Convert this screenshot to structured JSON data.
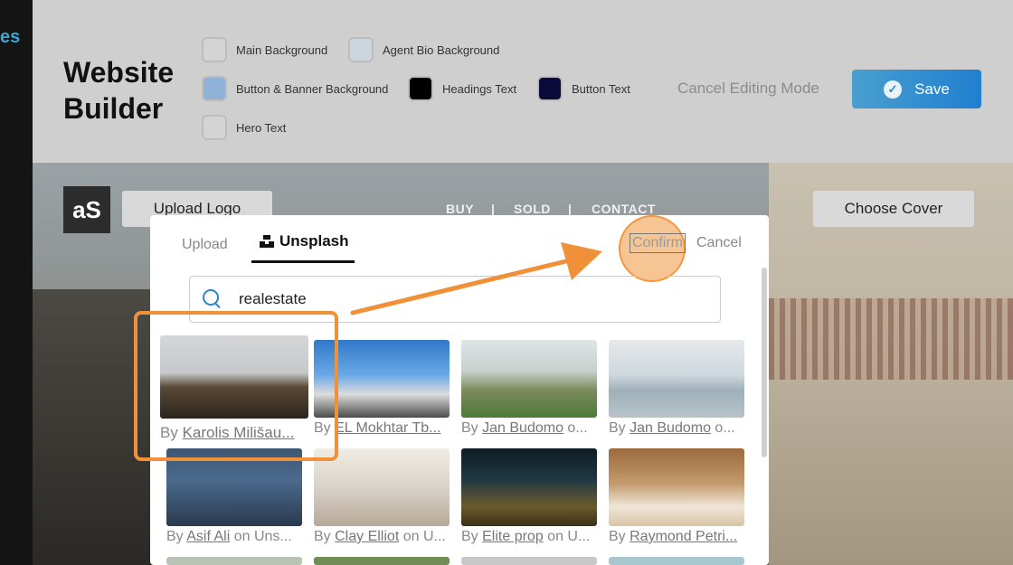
{
  "sidebar": {
    "fragment": "es"
  },
  "header": {
    "title_line1": "Website",
    "title_line2": "Builder",
    "colors": [
      {
        "label": "Main Background",
        "color": "#d4d4d4"
      },
      {
        "label": "Agent Bio Background",
        "color": "#cdd6de"
      },
      {
        "label": "Button & Banner Background",
        "color": "#8fb3d6"
      },
      {
        "label": "Headings Text",
        "color": "#000000"
      },
      {
        "label": "Button Text",
        "color": "#0b0b3a"
      },
      {
        "label": "Hero Text",
        "color": "#d4d4d4"
      }
    ],
    "cancel_editing_label": "Cancel Editing Mode",
    "save_label": "Save"
  },
  "page": {
    "logo_text": "aS",
    "upload_logo_label": "Upload Logo",
    "nav": [
      "BUY",
      "|",
      "SOLD",
      "|",
      "CONTACT"
    ],
    "choose_cover_label": "Choose Cover"
  },
  "modal": {
    "tab_upload": "Upload",
    "tab_unsplash": "Unsplash",
    "confirm_label": "Confirm",
    "cancel_label": "Cancel",
    "search_value": "realestate",
    "images": [
      {
        "by": "By",
        "author": "Karolis Milišau...",
        "tail": "",
        "icon": "photo-of-historic-building"
      },
      {
        "by": "By",
        "author": "EL Mokhtar Tb...",
        "tail": "",
        "icon": "photo-of-modern-building"
      },
      {
        "by": "By",
        "author": "Jan Budomo",
        "tail": " o...",
        "icon": "photo-of-park"
      },
      {
        "by": "By",
        "author": "Jan Budomo",
        "tail": " o...",
        "icon": "photo-of-lake-tower"
      },
      {
        "by": "By",
        "author": "Asif Ali",
        "tail": " on Uns...",
        "icon": "photo-of-apartment-tower"
      },
      {
        "by": "By",
        "author": "Clay Elliot",
        "tail": " on U...",
        "icon": "photo-of-kitchen"
      },
      {
        "by": "By",
        "author": "Elite prop",
        "tail": " on U...",
        "icon": "photo-of-home-theater"
      },
      {
        "by": "By",
        "author": "Raymond Petri...",
        "tail": "",
        "icon": "photo-of-plant-vase"
      }
    ]
  }
}
